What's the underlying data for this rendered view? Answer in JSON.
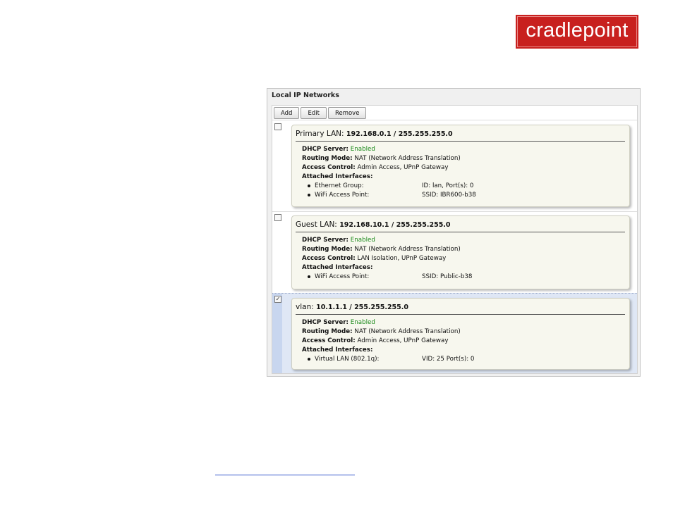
{
  "brand": {
    "logo_text": "cradlepoint",
    "color": "#c8201e"
  },
  "panel": {
    "title": "Local IP Networks",
    "toolbar": {
      "add": "Add",
      "edit": "Edit",
      "remove": "Remove"
    }
  },
  "networks": [
    {
      "name": "Primary LAN:",
      "address": "192.168.0.1 / 255.255.255.0",
      "selected": false,
      "dhcp_label": "DHCP Server:",
      "dhcp_value": "Enabled",
      "routing_label": "Routing Mode:",
      "routing_value": "NAT (Network Address Translation)",
      "access_label": "Access Control:",
      "access_value": "Admin Access, UPnP Gateway",
      "interfaces_label": "Attached Interfaces:",
      "interfaces": [
        {
          "type": "Ethernet Group:",
          "detail": "ID: lan, Port(s): 0"
        },
        {
          "type": "WiFi Access Point:",
          "detail": "SSID: IBR600-b38"
        }
      ]
    },
    {
      "name": "Guest LAN:",
      "address": "192.168.10.1 / 255.255.255.0",
      "selected": false,
      "dhcp_label": "DHCP Server:",
      "dhcp_value": "Enabled",
      "routing_label": "Routing Mode:",
      "routing_value": "NAT (Network Address Translation)",
      "access_label": "Access Control:",
      "access_value": "LAN Isolation, UPnP Gateway",
      "interfaces_label": "Attached Interfaces:",
      "interfaces": [
        {
          "type": "WiFi Access Point:",
          "detail": "SSID: Public-b38"
        }
      ]
    },
    {
      "name": "vlan:",
      "address": "10.1.1.1 / 255.255.255.0",
      "selected": true,
      "dhcp_label": "DHCP Server:",
      "dhcp_value": "Enabled",
      "routing_label": "Routing Mode:",
      "routing_value": "NAT (Network Address Translation)",
      "access_label": "Access Control:",
      "access_value": "Admin Access, UPnP Gateway",
      "interfaces_label": "Attached Interfaces:",
      "interfaces": [
        {
          "type": "Virtual LAN (802.1q):",
          "detail": "VID: 25 Port(s): 0"
        }
      ]
    }
  ],
  "colors": {
    "enabled_green": "#1b8a1b",
    "selection_blue": "#dfe7f5"
  }
}
